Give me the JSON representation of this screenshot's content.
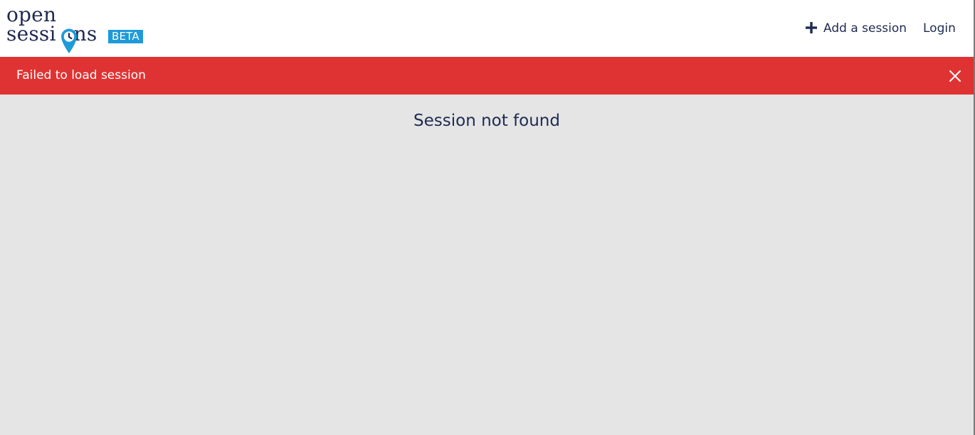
{
  "header": {
    "logo": {
      "line1": "open",
      "line2": "sessi",
      "line2_end": "ns",
      "badge": "BETA"
    },
    "nav": {
      "add_session_label": "Add a session",
      "login_label": "Login"
    }
  },
  "alert": {
    "message": "Failed to load session"
  },
  "main": {
    "message": "Session not found"
  },
  "icons": {
    "add": "plus-icon",
    "close": "close-icon",
    "logo_mark": "map-pin-clock-icon"
  },
  "colors": {
    "brand_navy": "#1f2a4f",
    "badge_blue": "#1e9ad9",
    "alert_red": "#df3333",
    "page_background": "#e5e5e6"
  }
}
